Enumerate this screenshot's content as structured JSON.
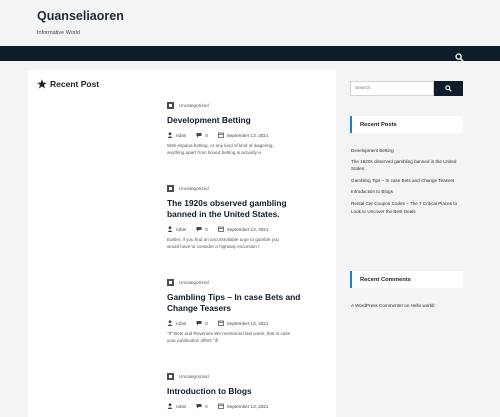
{
  "site": {
    "title": "Quanseliaoren",
    "description": "Informative World"
  },
  "nav": {
    "search_icon": "search-icon"
  },
  "main": {
    "section_title": "Recent Post",
    "section_icon": "star-icon",
    "posts": [
      {
        "category": "Uncategorized",
        "title": "Development Betting",
        "author": "robin",
        "comments": "0",
        "date": "September 13, 2021",
        "excerpt": "With espana betting, or any kind of kind of wagering, anything apart from boxed betting is actually a"
      },
      {
        "category": "Uncategorized",
        "title": "The 1920s observed gambling banned in the United States.",
        "author": "robin",
        "comments": "0",
        "date": "September 13, 2021",
        "excerpt": "Earlier, if you find an uncontrollable urge to gamble you would have to consider a highway excursion t"
      },
      {
        "category": "Uncategorized",
        "title": "Gambling Tips – In case Bets and Change Teasers",
        "author": "robin",
        "comments": "0",
        "date": "September 13, 2021",
        "excerpt": "\"If\" Bets and Reverses We mentioned last week, that in case your publication offers \"if/"
      },
      {
        "category": "Uncategorized",
        "title": "Introduction to Blogs",
        "author": "robin",
        "comments": "0",
        "date": "September 13, 2021",
        "excerpt": ""
      }
    ]
  },
  "sidebar": {
    "search_placeholder": "Search",
    "recent_posts_title": "Recent Posts",
    "recent_posts": [
      "Development Betting",
      "The 1920s observed gambling banned in the United States.",
      "Gambling Tips – In case Bets and Change Teasers",
      "Introduction to Blogs",
      "Rental Car Coupon Codes – The 7 Critical Places to Look to Uncover the Best Deals"
    ],
    "recent_comments_title": "Recent Comments",
    "recent_comments": [
      "A WordPress Commenter on Hello world!"
    ]
  },
  "colors": {
    "navbar": "#0f1c2a",
    "accent": "#1c7ed6"
  }
}
